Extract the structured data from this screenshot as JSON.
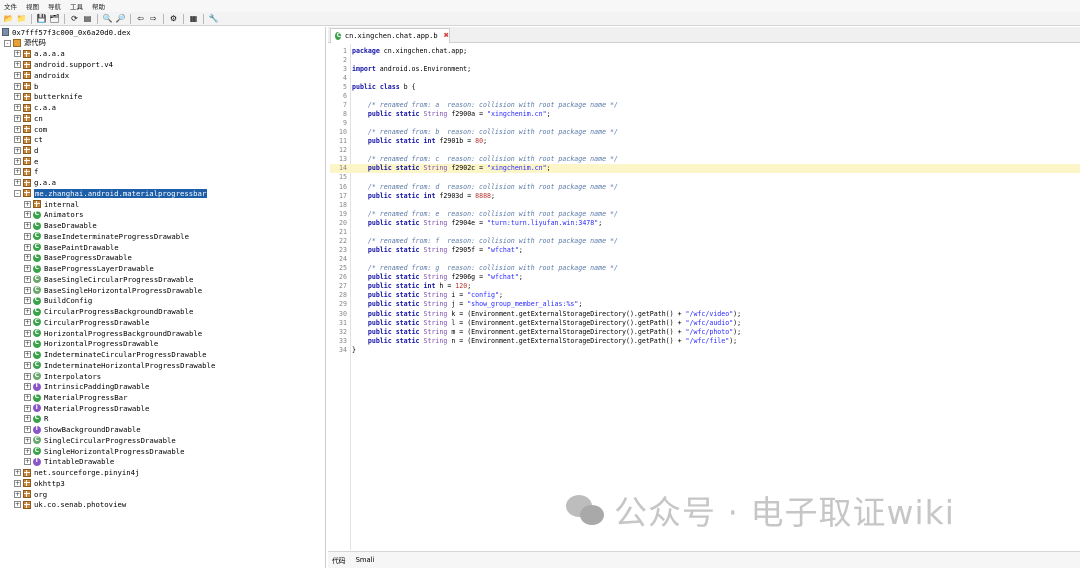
{
  "menu": [
    "文件",
    "视图",
    "导航",
    "工具",
    "帮助"
  ],
  "toolbar_icons": [
    "open-file-icon",
    "add-file-icon",
    "save-icon",
    "save-all-icon",
    "sync-icon",
    "flatten-icon",
    "search-icon",
    "find-class-icon",
    "back-icon",
    "forward-icon",
    "decompile-icon",
    "log-icon",
    "settings-icon"
  ],
  "tree": {
    "root": "0x7fff57f3c000_0x6a20d0.dex",
    "source": "源代码",
    "packages_top": [
      "a.a.a.a",
      "android.support.v4",
      "androidx",
      "b",
      "butterknife",
      "c.a.a",
      "cn",
      "com",
      "ct",
      "d",
      "e",
      "f",
      "g.a.a"
    ],
    "selected_package": "me.zhanghai.android.materialprogressbar",
    "sub": [
      {
        "label": "internal",
        "type": "package"
      },
      {
        "label": "Animators",
        "type": "class"
      },
      {
        "label": "BaseDrawable",
        "type": "class"
      },
      {
        "label": "BaseIndeterminateProgressDrawable",
        "type": "class"
      },
      {
        "label": "BasePaintDrawable",
        "type": "class"
      },
      {
        "label": "BaseProgressDrawable",
        "type": "class"
      },
      {
        "label": "BaseProgressLayerDrawable",
        "type": "class"
      },
      {
        "label": "BaseSingleCircularProgressDrawable",
        "type": "abstract"
      },
      {
        "label": "BaseSingleHorizontalProgressDrawable",
        "type": "abstract"
      },
      {
        "label": "BuildConfig",
        "type": "class"
      },
      {
        "label": "CircularProgressBackgroundDrawable",
        "type": "class"
      },
      {
        "label": "CircularProgressDrawable",
        "type": "class"
      },
      {
        "label": "HorizontalProgressBackgroundDrawable",
        "type": "class"
      },
      {
        "label": "HorizontalProgressDrawable",
        "type": "class"
      },
      {
        "label": "IndeterminateCircularProgressDrawable",
        "type": "class"
      },
      {
        "label": "IndeterminateHorizontalProgressDrawable",
        "type": "class"
      },
      {
        "label": "Interpolators",
        "type": "abstract"
      },
      {
        "label": "IntrinsicPaddingDrawable",
        "type": "interface"
      },
      {
        "label": "MaterialProgressBar",
        "type": "class"
      },
      {
        "label": "MaterialProgressDrawable",
        "type": "interface"
      },
      {
        "label": "R",
        "type": "class"
      },
      {
        "label": "ShowBackgroundDrawable",
        "type": "interface"
      },
      {
        "label": "SingleCircularProgressDrawable",
        "type": "abstract"
      },
      {
        "label": "SingleHorizontalProgressDrawable",
        "type": "class"
      },
      {
        "label": "TintableDrawable",
        "type": "interface"
      }
    ],
    "packages_bottom": [
      "net.sourceforge.pinyin4j",
      "okhttp3",
      "org",
      "uk.co.senab.photoview"
    ]
  },
  "tab": {
    "title": "cn.xingchen.chat.app.b"
  },
  "code": {
    "highlight_line": 14,
    "lines": [
      "package cn.xingchen.chat.app;",
      "",
      "import android.os.Environment;",
      "",
      "public class b {",
      "",
      "    /* renamed from: a  reason: collision with root package name */",
      "    public static String f2900a = \"xingchenim.cn\";",
      "",
      "    /* renamed from: b  reason: collision with root package name */",
      "    public static int f2901b = 80;",
      "",
      "    /* renamed from: c  reason: collision with root package name */",
      "    public static String f2902c = \"xingchenim.cn\";",
      "",
      "    /* renamed from: d  reason: collision with root package name */",
      "    public static int f2903d = 8888;",
      "",
      "    /* renamed from: e  reason: collision with root package name */",
      "    public static String f2904e = \"turn:turn.liyufan.win:3478\";",
      "",
      "    /* renamed from: f  reason: collision with root package name */",
      "    public static String f2905f = \"wfchat\";",
      "",
      "    /* renamed from: g  reason: collision with root package name */",
      "    public static String f2906g = \"wfchat\";",
      "    public static int h = 120;",
      "    public static String i = \"config\";",
      "    public static String j = \"show_group_member_alias:%s\";",
      "    public static String k = (Environment.getExternalStorageDirectory().getPath() + \"/wfc/video\");",
      "    public static String l = (Environment.getExternalStorageDirectory().getPath() + \"/wfc/audio\");",
      "    public static String m = (Environment.getExternalStorageDirectory().getPath() + \"/wfc/photo\");",
      "    public static String n = (Environment.getExternalStorageDirectory().getPath() + \"/wfc/file\");",
      "}"
    ]
  },
  "bottom_tabs": [
    "代码",
    "Smali"
  ],
  "watermark": "公众号 · 电子取证wiki"
}
